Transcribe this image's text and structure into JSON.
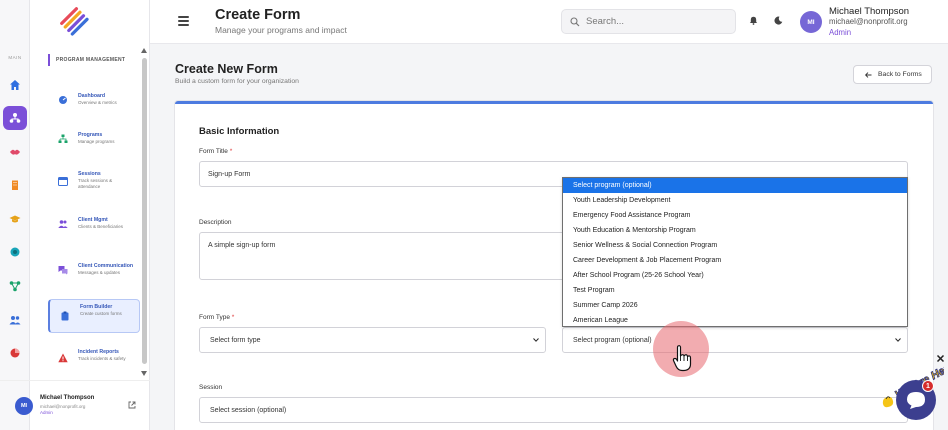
{
  "rail": {
    "section_label": "MAIN",
    "items": [
      {
        "icon": "home-icon",
        "color": "#2f6fe0"
      },
      {
        "icon": "org-chart-icon",
        "color": "#ffffff",
        "active": true
      },
      {
        "icon": "handshake-icon",
        "color": "#e04a6a"
      },
      {
        "icon": "building-icon",
        "color": "#f08a24"
      },
      {
        "icon": "graduation-cap-icon",
        "color": "#e6a21a"
      },
      {
        "icon": "globe-icon",
        "color": "#18a4b8"
      },
      {
        "icon": "network-icon",
        "color": "#1aa36a"
      },
      {
        "icon": "users-icon",
        "color": "#3a6fd8"
      },
      {
        "icon": "pie-chart-icon",
        "color": "#d93838"
      }
    ]
  },
  "sidebar": {
    "section_title": "PROGRAM MANAGEMENT",
    "items": [
      {
        "title": "Dashboard",
        "subtitle": "Overview & metrics",
        "icon": "gauge-icon"
      },
      {
        "title": "Programs",
        "subtitle": "Manage programs",
        "icon": "sitemap-icon"
      },
      {
        "title": "Sessions",
        "subtitle": "Track sessions & attendance",
        "icon": "calendar-icon"
      },
      {
        "title": "Client Mgmt",
        "subtitle": "Clients & Beneficiaries",
        "icon": "users-icon"
      },
      {
        "title": "Client Communication",
        "subtitle": "Messages & updates",
        "icon": "chat-icon"
      },
      {
        "title": "Form Builder",
        "subtitle": "Create custom forms",
        "icon": "clipboard-icon",
        "active": true
      },
      {
        "title": "Incident Reports",
        "subtitle": "Track incidents & safety",
        "icon": "warning-icon"
      }
    ],
    "user": {
      "initials": "MI",
      "name": "Michael Thompson",
      "email": "michael@nonprofit.org",
      "role": "Admin"
    }
  },
  "header": {
    "title": "Create Form",
    "subtitle": "Manage your programs and impact",
    "search_placeholder": "Search...",
    "user": {
      "initials": "MI",
      "name": "Michael Thompson",
      "email": "michael@nonprofit.org",
      "role": "Admin"
    }
  },
  "main": {
    "title": "Create New Form",
    "subtitle": "Build a custom form for your organization",
    "back_label": "Back to Forms",
    "section_title": "Basic Information",
    "form_title_label": "Form Title",
    "form_title_value": "Sign-up Form",
    "description_label": "Description",
    "description_value": "A simple sign-up form",
    "form_type_label": "Form Type",
    "form_type_value": "Select form type",
    "program_value": "Select program (optional)",
    "session_label": "Session",
    "session_value": "Select session (optional)",
    "required_mark": "*"
  },
  "program_dropdown": {
    "options": [
      "Select program (optional)",
      "Youth Leadership Development",
      "Emergency Food Assistance Program",
      "Youth Education & Mentorship Program",
      "Senior Wellness & Social Connection Program",
      "Career Development & Job Placement Program",
      "After School Program (25-26 School Year)",
      "Test Program",
      "Summer Camp 2026",
      "American League"
    ],
    "selected_index": 0
  },
  "chat_widget": {
    "badge_count": "1",
    "brand_text": "We Are Here!"
  },
  "colors": {
    "accent": "#7b4fd8",
    "primary_blue": "#4d7be0",
    "dropdown_highlight": "#1a73e8",
    "chat_button": "#3c3f8f"
  }
}
